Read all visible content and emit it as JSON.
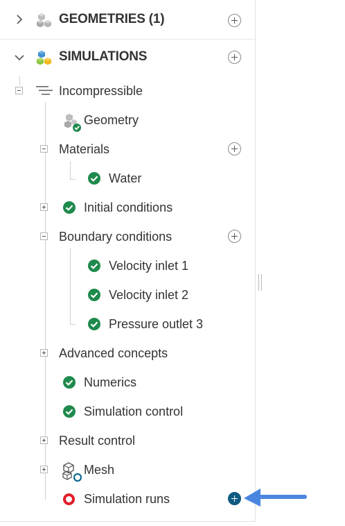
{
  "geometries": {
    "title": "GEOMETRIES (1)",
    "icon": "cubes-icon"
  },
  "simulations": {
    "title": "SIMULATIONS",
    "icon": "cubes-color-icon"
  },
  "tree": {
    "root": "Incompressible",
    "geometry": "Geometry",
    "materials": "Materials",
    "water": "Water",
    "initial_conditions": "Initial conditions",
    "boundary_conditions": "Boundary conditions",
    "velocity_inlet_1": "Velocity inlet 1",
    "velocity_inlet_2": "Velocity inlet 2",
    "pressure_outlet_3": "Pressure outlet 3",
    "advanced_concepts": "Advanced concepts",
    "numerics": "Numerics",
    "simulation_control": "Simulation control",
    "result_control": "Result control",
    "mesh": "Mesh",
    "simulation_runs": "Simulation runs"
  },
  "colors": {
    "status_ok": "#1e8a4c",
    "status_missing": "#e0202b",
    "accent_plus": "#0d5b80",
    "arrow": "#4a86e0"
  }
}
